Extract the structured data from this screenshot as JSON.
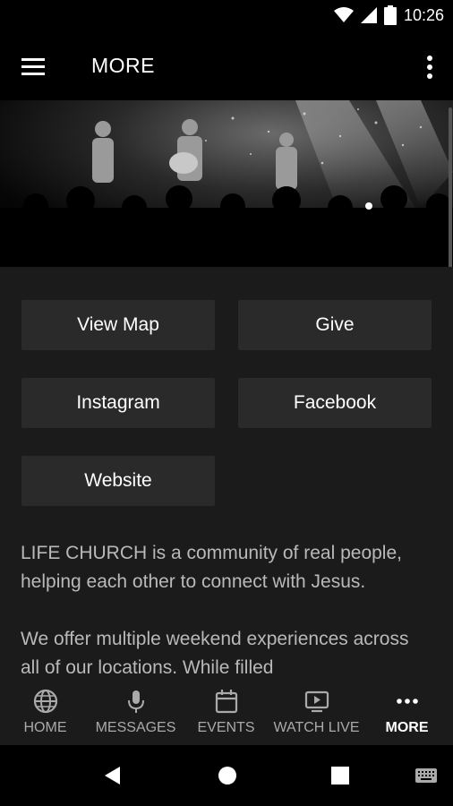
{
  "status_bar": {
    "time": "10:26"
  },
  "app_bar": {
    "title": "MORE"
  },
  "hero_image": {
    "description_name": "concert-stage-photo"
  },
  "buttons": {
    "view_map": "View Map",
    "give": "Give",
    "instagram": "Instagram",
    "facebook": "Facebook",
    "website": "Website"
  },
  "description": {
    "paragraph1": "LIFE CHURCH is a community of real people, helping each other to connect with Jesus.",
    "paragraph2": "We offer multiple weekend experiences across all of our locations. While filled"
  },
  "tabs": [
    {
      "label": "HOME",
      "icon": "globe-icon",
      "active": false
    },
    {
      "label": "MESSAGES",
      "icon": "microphone-icon",
      "active": false
    },
    {
      "label": "EVENTS",
      "icon": "calendar-icon",
      "active": false
    },
    {
      "label": "WATCH LIVE",
      "icon": "tv-play-icon",
      "active": false
    },
    {
      "label": "MORE",
      "icon": "more-dots-icon",
      "active": true
    }
  ],
  "colors": {
    "background": "#1b1b1c",
    "button": "#2a2a2b",
    "text_muted": "#b9b9b9"
  }
}
